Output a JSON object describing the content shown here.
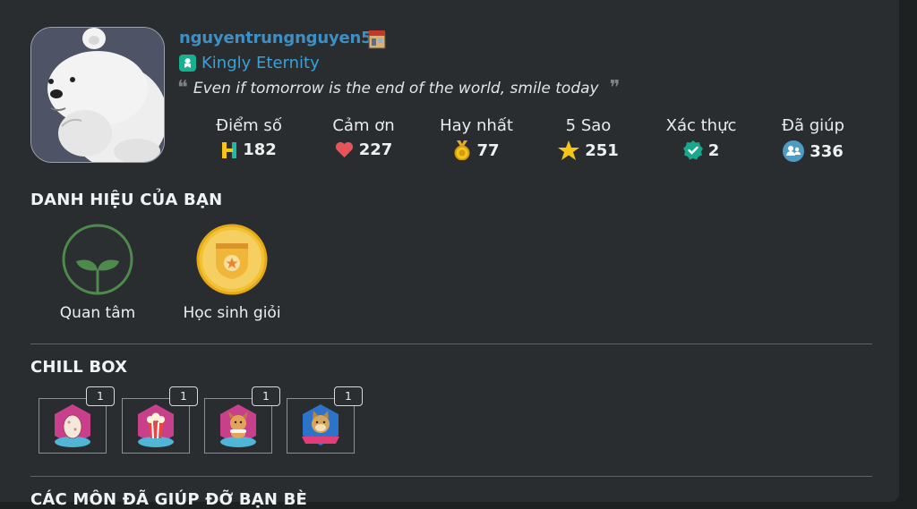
{
  "profile": {
    "username": "nguyentrungnguyen5",
    "rank": "Kingly Eternity",
    "quote": "Even if tomorrow is the end of the world, smile today"
  },
  "stats": [
    {
      "label": "Điểm số",
      "value": "182",
      "icon": "points-h-icon"
    },
    {
      "label": "Cảm ơn",
      "value": "227",
      "icon": "heart-icon"
    },
    {
      "label": "Hay nhất",
      "value": "77",
      "icon": "medal-icon"
    },
    {
      "label": "5 Sao",
      "value": "251",
      "icon": "star-icon"
    },
    {
      "label": "Xác thực",
      "value": "2",
      "icon": "verified-icon"
    },
    {
      "label": "Đã giúp",
      "value": "336",
      "icon": "helped-users-icon"
    }
  ],
  "titles_section": {
    "heading": "DANH HIỆU CỦA BẠN",
    "items": [
      {
        "label": "Quan tâm",
        "icon": "sprout-icon"
      },
      {
        "label": "Học sinh giỏi",
        "icon": "star-shield-icon"
      }
    ]
  },
  "chill_box": {
    "heading": "CHILL BOX",
    "items": [
      {
        "count": "1",
        "icon": "egg-sticker-icon"
      },
      {
        "count": "1",
        "icon": "popcorn-sticker-icon"
      },
      {
        "count": "1",
        "icon": "dog-sticker-icon"
      },
      {
        "count": "1",
        "icon": "doge-sticker-icon"
      }
    ]
  },
  "helped_subjects": {
    "heading": "CÁC MÔN ĐÃ GIÚP ĐỠ BẠN BÈ"
  },
  "colors": {
    "background": "#292d2f",
    "username": "#3f8fc4",
    "rank": "#3aa1d8",
    "accent_green": "#16b28f"
  }
}
